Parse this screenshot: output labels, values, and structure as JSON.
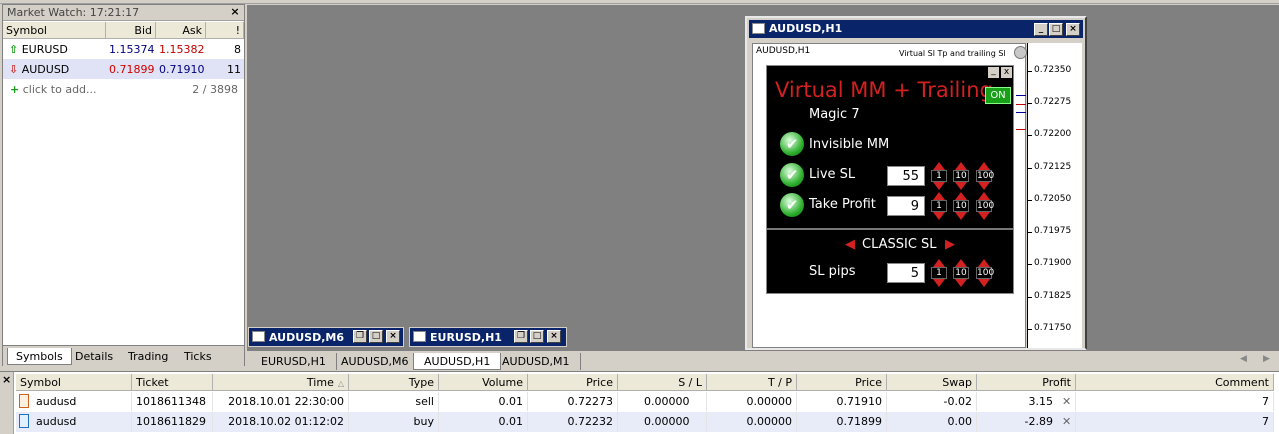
{
  "market_watch": {
    "title": "Market Watch: 17:21:17",
    "columns": [
      "Symbol",
      "Bid",
      "Ask",
      "!"
    ],
    "rows": [
      {
        "symbol": "EURUSD",
        "bid": "1.15374",
        "ask": "1.15382",
        "spread": "8",
        "direction": "up"
      },
      {
        "symbol": "AUDUSD",
        "bid": "0.71899",
        "ask": "0.71910",
        "spread": "11",
        "direction": "down"
      }
    ],
    "add_label": "click to add...",
    "count": "2 / 3898",
    "tabs": [
      "Symbols",
      "Details",
      "Trading",
      "Ticks"
    ]
  },
  "chart_window": {
    "title": "AUDUSD,H1",
    "symbol_label": "AUDUSD,H1",
    "ea_name": "Virtual Sl Tp and trailing Sl",
    "price_ticks": [
      "0.72350",
      "0.72275",
      "0.72200",
      "0.72125",
      "0.72050",
      "0.71975",
      "0.71900",
      "0.71825",
      "0.71750"
    ]
  },
  "ea_panel": {
    "title": "Virtual MM + Trailing",
    "on_label": "ON",
    "magic": "Magic 7",
    "invisible_mm": "Invisible MM",
    "live_sl": "Live SL",
    "live_sl_value": "55",
    "take_profit": "Take Profit",
    "take_profit_value": "9",
    "mode": "CLASSIC SL",
    "sl_pips": "SL pips",
    "sl_pips_value": "5",
    "steps": [
      "1",
      "10",
      "100"
    ],
    "min_label": "_",
    "close_label": "x"
  },
  "minimized_windows": [
    "AUDUSD,M6",
    "EURUSD,H1"
  ],
  "chart_tabs": [
    "EURUSD,H1",
    "AUDUSD,M6",
    "AUDUSD,H1",
    "AUDUSD,M1"
  ],
  "active_chart_tab": "AUDUSD,H1",
  "terminal": {
    "columns": [
      "Symbol",
      "Ticket",
      "Time",
      "Type",
      "Volume",
      "Price",
      "S / L",
      "T / P",
      "Price",
      "Swap",
      "Profit",
      "Comment"
    ],
    "rows": [
      {
        "symbol": "audusd",
        "ticket": "1018611348",
        "time": "2018.10.01 22:30:00",
        "type": "sell",
        "volume": "0.01",
        "price": "0.72273",
        "sl": "0.00000",
        "tp": "0.00000",
        "cur_price": "0.71910",
        "swap": "-0.02",
        "profit": "3.15",
        "comment": "7"
      },
      {
        "symbol": "audusd",
        "ticket": "1018611829",
        "time": "2018.10.02 01:12:02",
        "type": "buy",
        "volume": "0.01",
        "price": "0.72232",
        "sl": "0.00000",
        "tp": "0.00000",
        "cur_price": "0.71899",
        "swap": "0.00",
        "profit": "-2.89",
        "comment": "7"
      }
    ]
  },
  "colors": {
    "titlebar": "#0a246a",
    "panel_red": "#d32020",
    "on_green": "#18a018",
    "bid_down": "#d00000",
    "ask_red": "#c00000",
    "bid_blue": "#000080"
  }
}
